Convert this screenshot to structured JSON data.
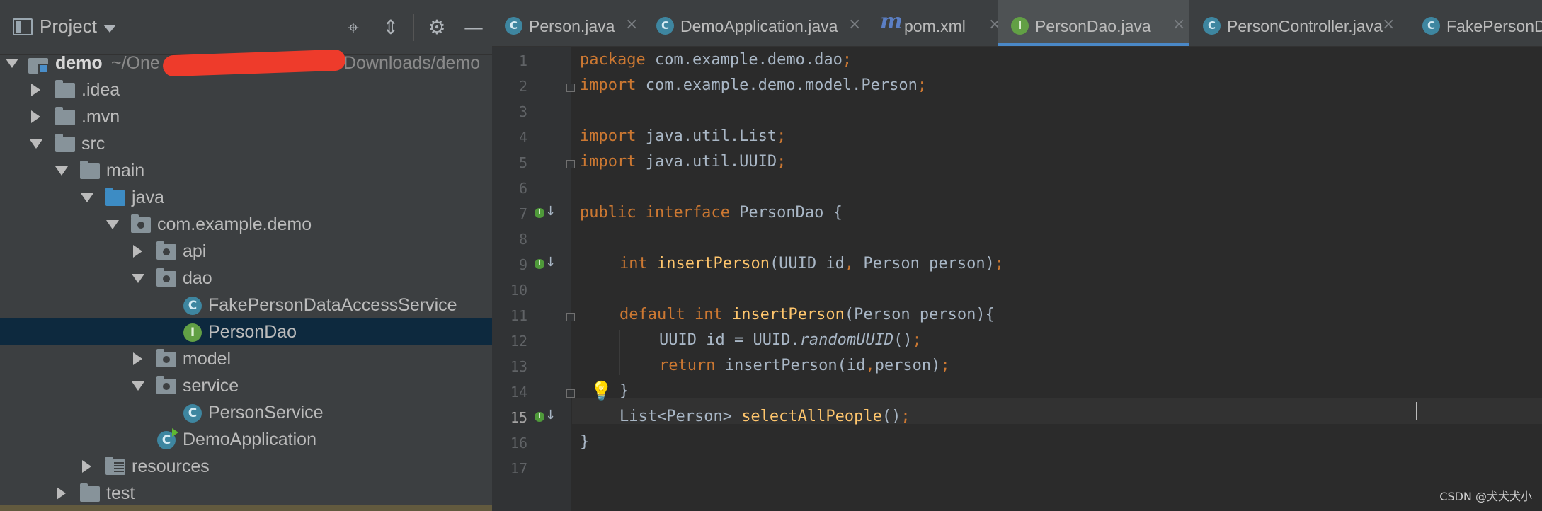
{
  "project_panel": {
    "title": "Project",
    "toolbar": {
      "locate_icon": "⌖",
      "collapse_icon": "⇕",
      "settings_icon": "⚙",
      "hide_icon": "—"
    },
    "tree": {
      "root_name": "demo",
      "root_path_prefix": "~/One",
      "root_path_suffix": "/Downloads/demo",
      "idea": ".idea",
      "mvn": ".mvn",
      "src": "src",
      "main": "main",
      "java": "java",
      "package": "com.example.demo",
      "api": "api",
      "dao": "dao",
      "fake_service": "FakePersonDataAccessService",
      "person_dao": "PersonDao",
      "model": "model",
      "service": "service",
      "person_service": "PersonService",
      "demo_application": "DemoApplication",
      "resources": "resources",
      "test": "test"
    }
  },
  "tabs": [
    {
      "label": "Person.java",
      "icon": "C"
    },
    {
      "label": "DemoApplication.java",
      "icon": "C"
    },
    {
      "label": "pom.xml",
      "icon": "m"
    },
    {
      "label": "PersonDao.java",
      "icon": "I"
    },
    {
      "label": "PersonController.java",
      "icon": "C"
    },
    {
      "label": "FakePersonDa",
      "icon": "C"
    }
  ],
  "tab_close": "×",
  "editor": {
    "line_numbers": [
      "1",
      "2",
      "3",
      "4",
      "5",
      "6",
      "7",
      "8",
      "9",
      "10",
      "11",
      "12",
      "13",
      "14",
      "15",
      "16",
      "17"
    ],
    "code": {
      "l1_kw": "package",
      "l1_rest": " com.example.demo.dao",
      "l1_semi": ";",
      "l2_kw": "import",
      "l2_rest": " com.example.demo.model.Person",
      "l2_semi": ";",
      "l4_kw": "import",
      "l4_rest": " java.util.List",
      "l4_semi": ";",
      "l5_kw": "import",
      "l5_rest": " java.util.UUID",
      "l5_semi": ";",
      "l7_kw": "public interface",
      "l7_rest": " PersonDao {",
      "l9_kw": "int",
      "l9_fn": " insertPerson",
      "l9_a": "(UUID id",
      "l9_comma": ",",
      "l9_b": " Person person)",
      "l9_semi": ";",
      "l11_kw": "default int",
      "l11_fn": " insertPerson",
      "l11_rest": "(Person person){",
      "l12_a": "UUID id = UUID.",
      "l12_it": "randomUUID",
      "l12_b": "()",
      "l12_semi": ";",
      "l13_kw": "return",
      "l13_a": " insertPerson(id",
      "l13_comma": ",",
      "l13_b": "person)",
      "l13_semi": ";",
      "l14": "}",
      "l15_a": "List<Person> ",
      "l15_fn": "selectAllPeople",
      "l15_b": "()",
      "l15_semi": ";",
      "l16": "}"
    },
    "bulb_icon": "💡",
    "impl_arrow": "↓",
    "impl_letter": "I"
  },
  "watermark": "CSDN @犬犬犬小"
}
